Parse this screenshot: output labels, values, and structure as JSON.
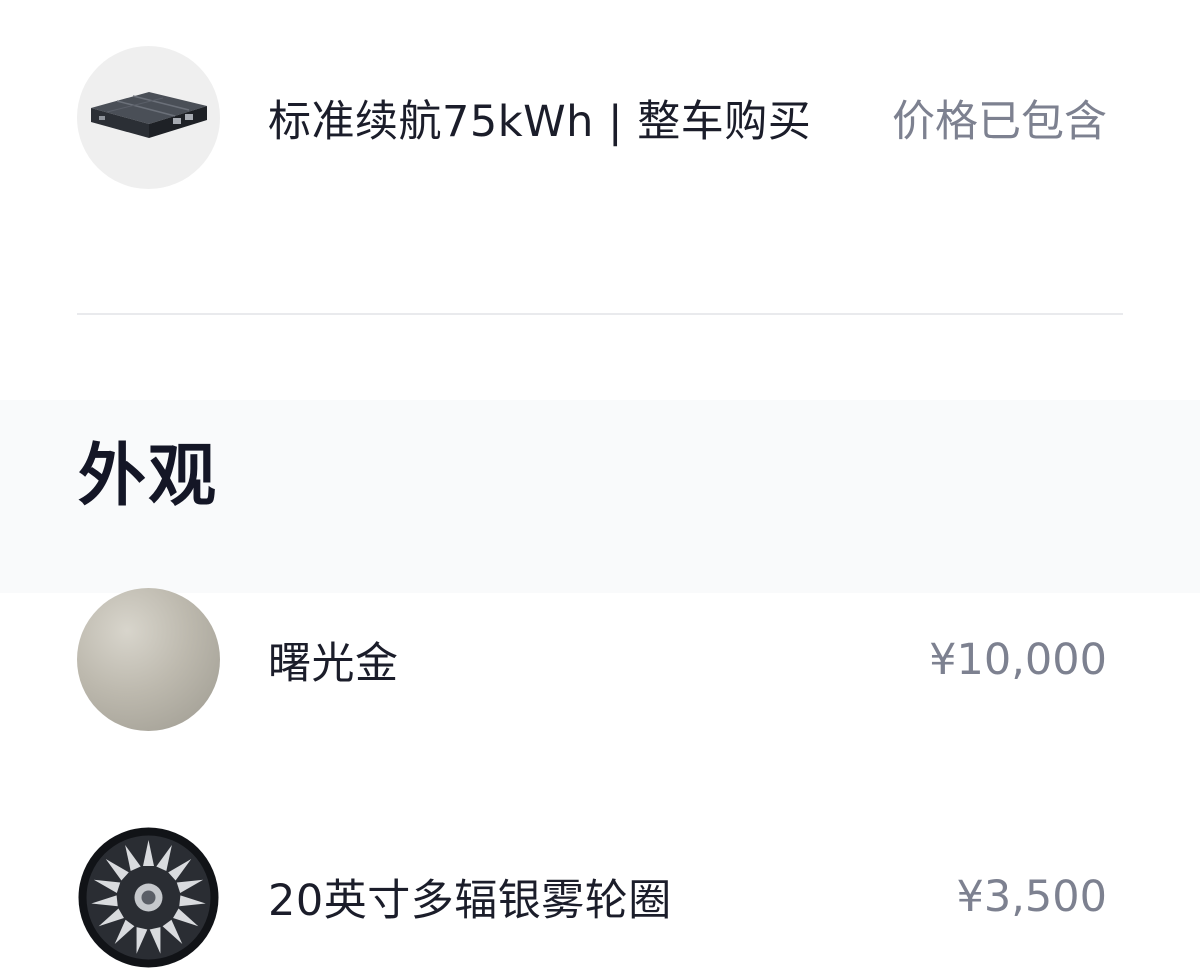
{
  "battery": {
    "label": "标准续航75kWh | 整车购买",
    "price": "价格已包含",
    "icon": "battery-pack-icon"
  },
  "exterior": {
    "title": "外观",
    "items": [
      {
        "label": "曙光金",
        "price": "¥10,000",
        "swatch_color": "#b8b5aa",
        "icon": "color-swatch-icon"
      },
      {
        "label": "20英寸多辐银雾轮圈",
        "price": "¥3,500",
        "icon": "wheel-rim-icon"
      }
    ]
  },
  "colors": {
    "label_text": "#1b1d2a",
    "price_text": "#7d8190",
    "section_band": "#f9fafb",
    "divider": "#e9eaed"
  }
}
